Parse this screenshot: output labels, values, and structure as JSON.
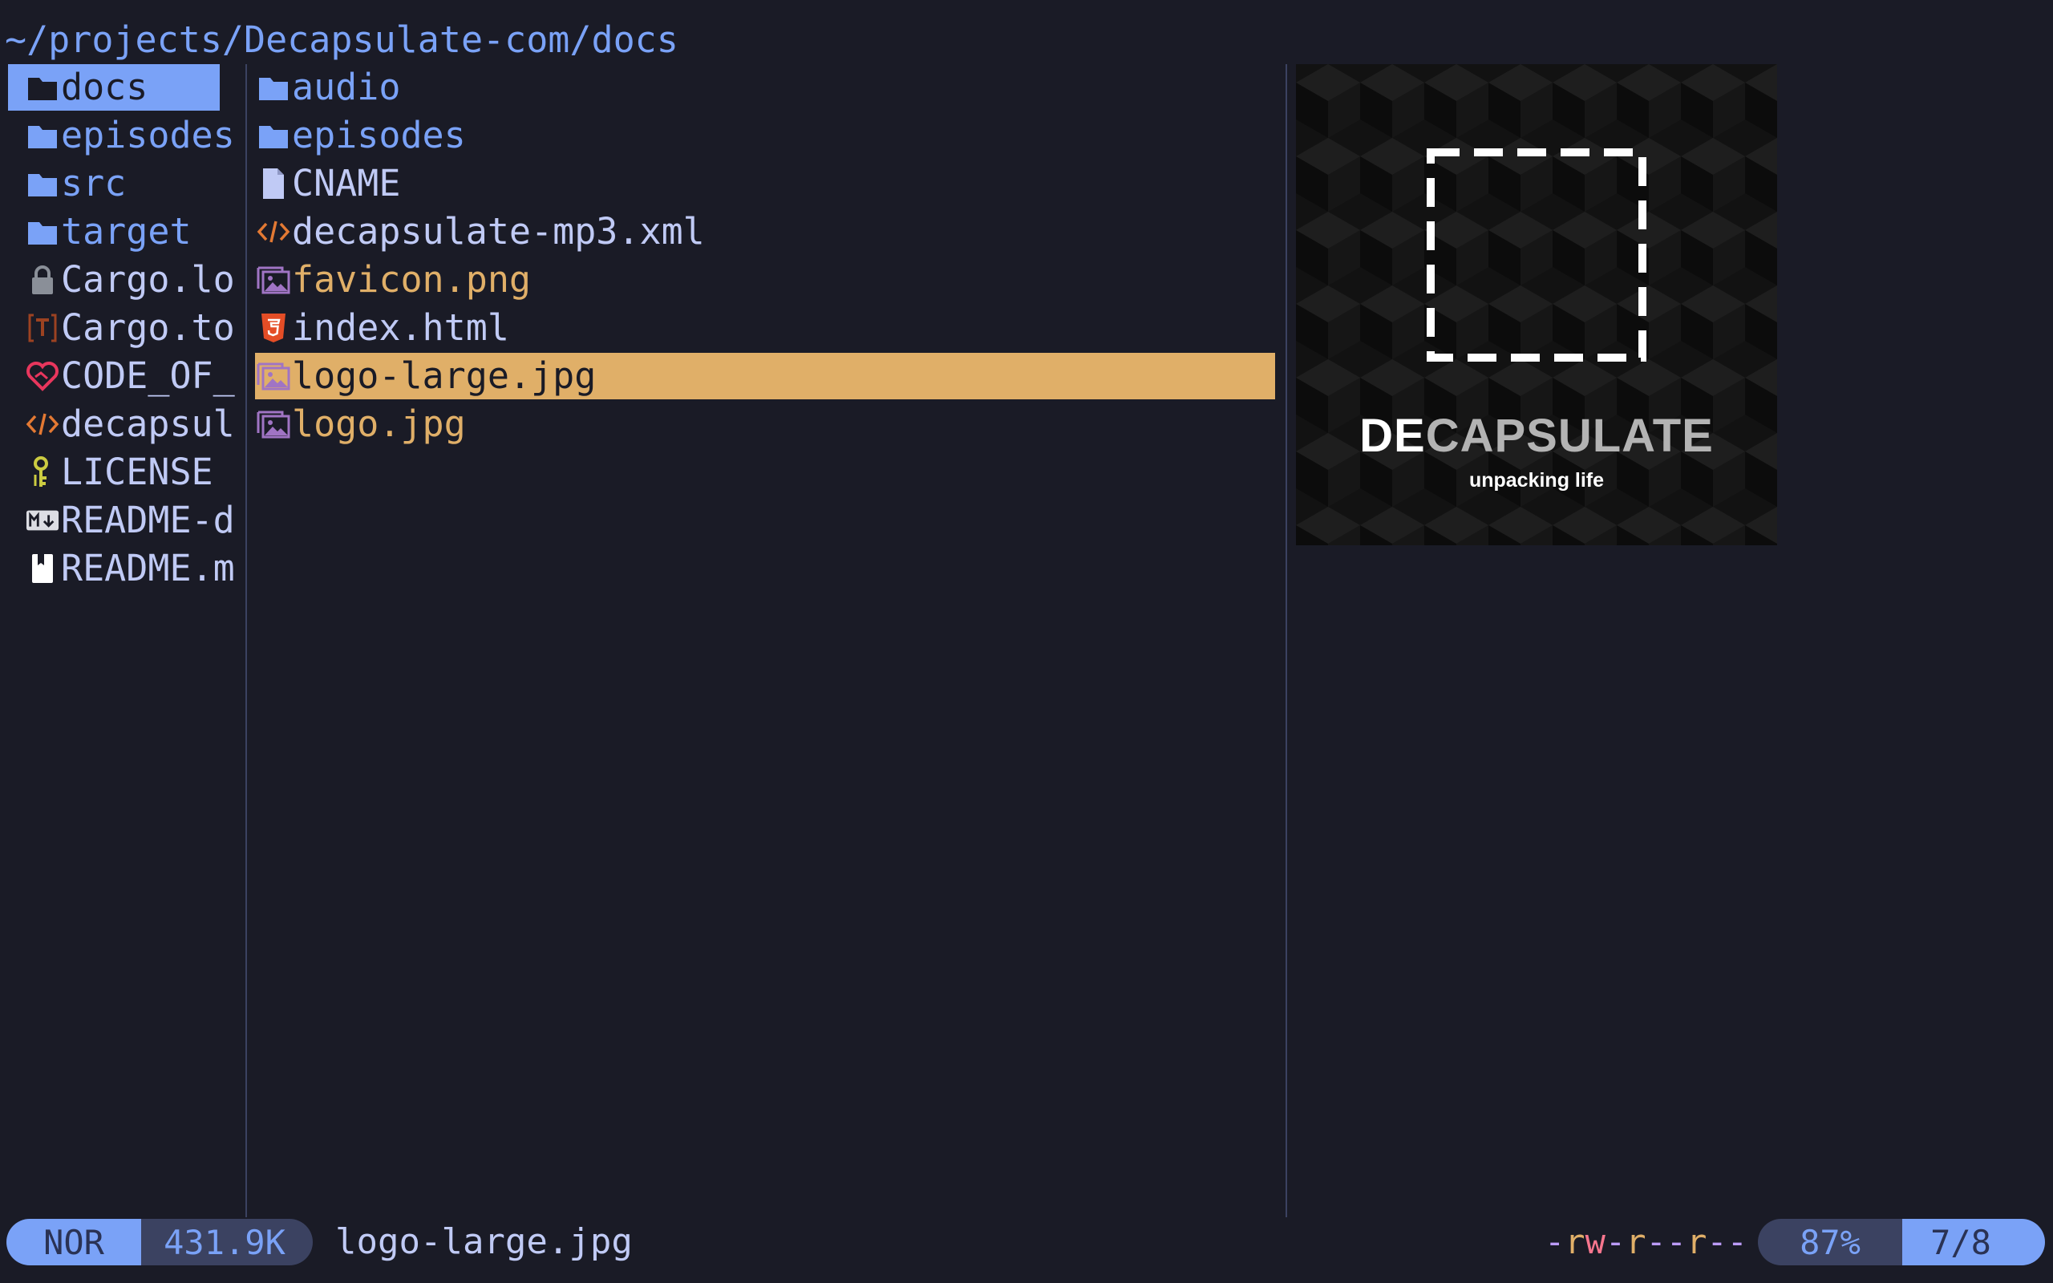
{
  "header": {
    "path": "~/projects/Decapsulate-com/docs"
  },
  "parent": {
    "items": [
      {
        "label": "docs",
        "icon": "folder-icon",
        "kind": "dir",
        "selected": true
      },
      {
        "label": "episodes",
        "icon": "folder-icon",
        "kind": "dir"
      },
      {
        "label": "src",
        "icon": "folder-icon",
        "kind": "dir"
      },
      {
        "label": "target",
        "icon": "folder-icon",
        "kind": "dir"
      },
      {
        "label": "Cargo.lo",
        "icon": "lock-icon",
        "kind": "file"
      },
      {
        "label": "Cargo.to",
        "icon": "toml-icon",
        "kind": "file"
      },
      {
        "label": "CODE_OF_",
        "icon": "heart-handshake-icon",
        "kind": "file"
      },
      {
        "label": "decapsul",
        "icon": "code-icon",
        "kind": "file"
      },
      {
        "label": "LICENSE",
        "icon": "key-icon",
        "kind": "file"
      },
      {
        "label": "README-d",
        "icon": "markdown-icon",
        "kind": "file"
      },
      {
        "label": "README.m",
        "icon": "book-icon",
        "kind": "file"
      }
    ]
  },
  "current": {
    "items": [
      {
        "label": "audio",
        "icon": "folder-icon",
        "kind": "dir"
      },
      {
        "label": "episodes",
        "icon": "folder-icon",
        "kind": "dir"
      },
      {
        "label": "CNAME",
        "icon": "file-icon",
        "kind": "file"
      },
      {
        "label": "decapsulate-mp3.xml",
        "icon": "code-icon",
        "kind": "file"
      },
      {
        "label": "favicon.png",
        "icon": "image-icon",
        "kind": "image"
      },
      {
        "label": "index.html",
        "icon": "html5-icon",
        "kind": "file"
      },
      {
        "label": "logo-large.jpg",
        "icon": "image-icon",
        "kind": "image",
        "selected": true
      },
      {
        "label": "logo.jpg",
        "icon": "image-icon",
        "kind": "image"
      }
    ]
  },
  "preview": {
    "title_de": "DE",
    "title_rest": "CAPSULATE",
    "tagline": "unpacking life"
  },
  "status": {
    "mode": "NOR",
    "size": "431.9K",
    "filename": "logo-large.jpg",
    "perms": "-rw-r--r--",
    "percent": "87%",
    "position": "7/8"
  },
  "colors": {
    "background": "#1a1b26",
    "accent_blue": "#7aa2f7",
    "selection_blue": "#7aa2f7",
    "selection_orange": "#e0af68",
    "image_text": "#e0af68",
    "text": "#c0caf5",
    "divider": "#3b4261"
  }
}
